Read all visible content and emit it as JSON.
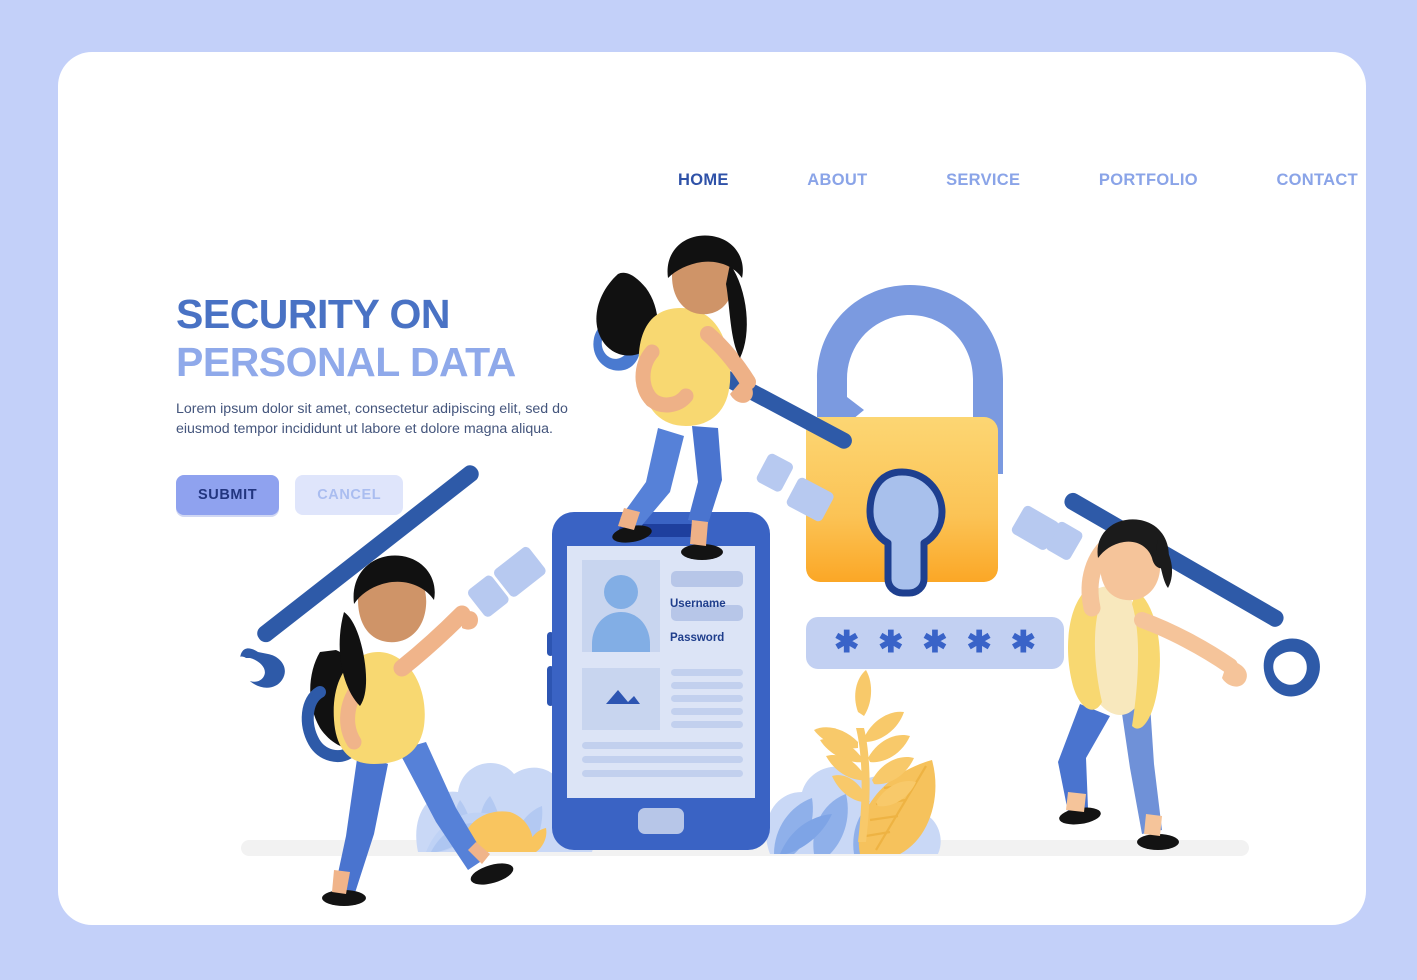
{
  "page": {
    "background_color": "#c3d0f9",
    "card_color": "#ffffff"
  },
  "nav": {
    "items": [
      {
        "label": "HOME",
        "active": true
      },
      {
        "label": "ABOUT",
        "active": false
      },
      {
        "label": "SERVICE",
        "active": false
      },
      {
        "label": "PORTFOLIO",
        "active": false
      },
      {
        "label": "CONTACT",
        "active": false
      }
    ],
    "active_color": "#2f52a8",
    "inactive_color": "#8aa4e8"
  },
  "hero": {
    "title_line1": "SECURITY ON",
    "title_line2": "PERSONAL DATA",
    "title_line1_color": "#4972c4",
    "title_line2_color": "#8fa9ea",
    "subtitle": "Lorem ipsum dolor sit amet, consectetur adipiscing elit, sed do eiusmod tempor incididunt ut labore et dolore magna aliqua.",
    "subtitle_color": "#44557c"
  },
  "buttons": {
    "submit_label": "SUBMIT",
    "submit_bg": "#8fa2ef",
    "submit_text_color": "#22357f",
    "cancel_label": "CANCEL",
    "cancel_bg": "#dfe5fb",
    "cancel_text_color": "#aabdf0"
  },
  "phone_mockup": {
    "username_label": "Username",
    "password_label": "Password",
    "frame_color": "#3a63c4",
    "screen_color": "#dce4f6",
    "field_color": "#b7c6e8",
    "label_color": "#1f3e8c"
  },
  "password_box": {
    "masked_value": "* * * * *",
    "dot_count": 5,
    "box_color": "#c2d0f2",
    "asterisk_color": "#3963c8"
  },
  "padlock": {
    "body_color_top": "#fbd06a",
    "body_color_bottom": "#fba726",
    "shackle_color": "#7b9ae0",
    "keyhole_fill": "#a8c0ec",
    "keyhole_stroke": "#1e3f8f",
    "state": "unlocked"
  },
  "characters": [
    {
      "name": "woman-left-carrying-key",
      "shirt_color": "#f8d871",
      "pants_color": "#4a74cf",
      "hair_color": "#111111",
      "skin_color": "#f0b48a",
      "key_color": "#2e5aa8"
    },
    {
      "name": "woman-center-on-phone",
      "shirt_color": "#f8d871",
      "pants_color": "#4a74cf",
      "hair_color": "#111111",
      "skin_color": "#e8a878",
      "key_color": "#2e5aa8"
    },
    {
      "name": "man-right-lifting-key",
      "jacket_color": "#f8d871",
      "shirt_color": "#f8e8bd",
      "pants_color": "#6f91d8",
      "hair_color": "#1b1b1b",
      "skin_color": "#f5c49a",
      "key_color": "#2e5aa8"
    }
  ],
  "decor": {
    "bush_color_light": "#c4d4f4",
    "bush_color_mid": "#8fb0ea",
    "leaf_color": "#f9c55f",
    "ground_color": "#f2f2f2"
  }
}
